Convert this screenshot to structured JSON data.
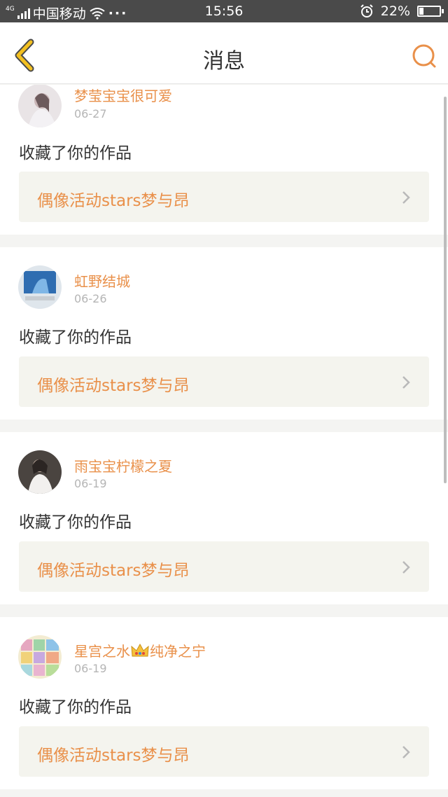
{
  "status_bar": {
    "signal_tag": "4G",
    "carrier": "中国移动",
    "more": "···",
    "time": "15:56",
    "battery_text": "22%",
    "battery_level": 0.22
  },
  "nav": {
    "title": "消息",
    "back_icon": "back-chevron-icon",
    "search_icon": "search-icon"
  },
  "colors": {
    "accent": "#e9904a",
    "back_yellow": "#f3c020"
  },
  "messages": [
    {
      "user": "梦莹宝宝很可爱",
      "date": "06-27",
      "action": "收藏了你的作品",
      "work": "偶像活动stars梦与昂"
    },
    {
      "user": "虹野结城",
      "date": "06-26",
      "action": "收藏了你的作品",
      "work": "偶像活动stars梦与昂"
    },
    {
      "user": "雨宝宝柠檬之夏",
      "date": "06-19",
      "action": "收藏了你的作品",
      "work": "偶像活动stars梦与昂"
    },
    {
      "user_a": "星宫之水",
      "user_b": "纯净之宁",
      "date": "06-19",
      "action": "收藏了你的作品",
      "work": "偶像活动stars梦与昂"
    }
  ]
}
